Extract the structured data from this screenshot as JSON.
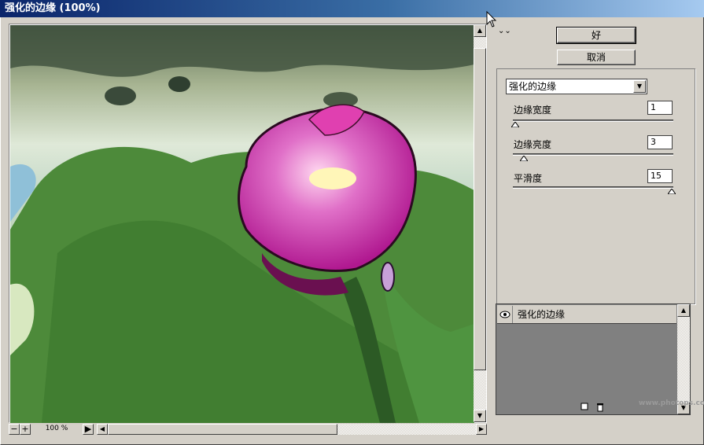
{
  "window": {
    "title": "强化的边缘 (100%)"
  },
  "preview": {
    "zoom": "100 %"
  },
  "buttons": {
    "ok": "好",
    "cancel": "取消"
  },
  "filter_select": {
    "value": "强化的边缘"
  },
  "params": [
    {
      "label": "边缘宽度",
      "value": "1"
    },
    {
      "label": "边缘亮度",
      "value": "3"
    },
    {
      "label": "平滑度",
      "value": "15"
    }
  ],
  "layers": [
    {
      "name": "强化的边缘"
    }
  ],
  "watermark": "www.photops.co",
  "icons": {
    "collapse": "double-chevron-down-icon",
    "eye": "eye-icon",
    "new_layer": "new-layer-icon",
    "delete": "trash-icon"
  }
}
